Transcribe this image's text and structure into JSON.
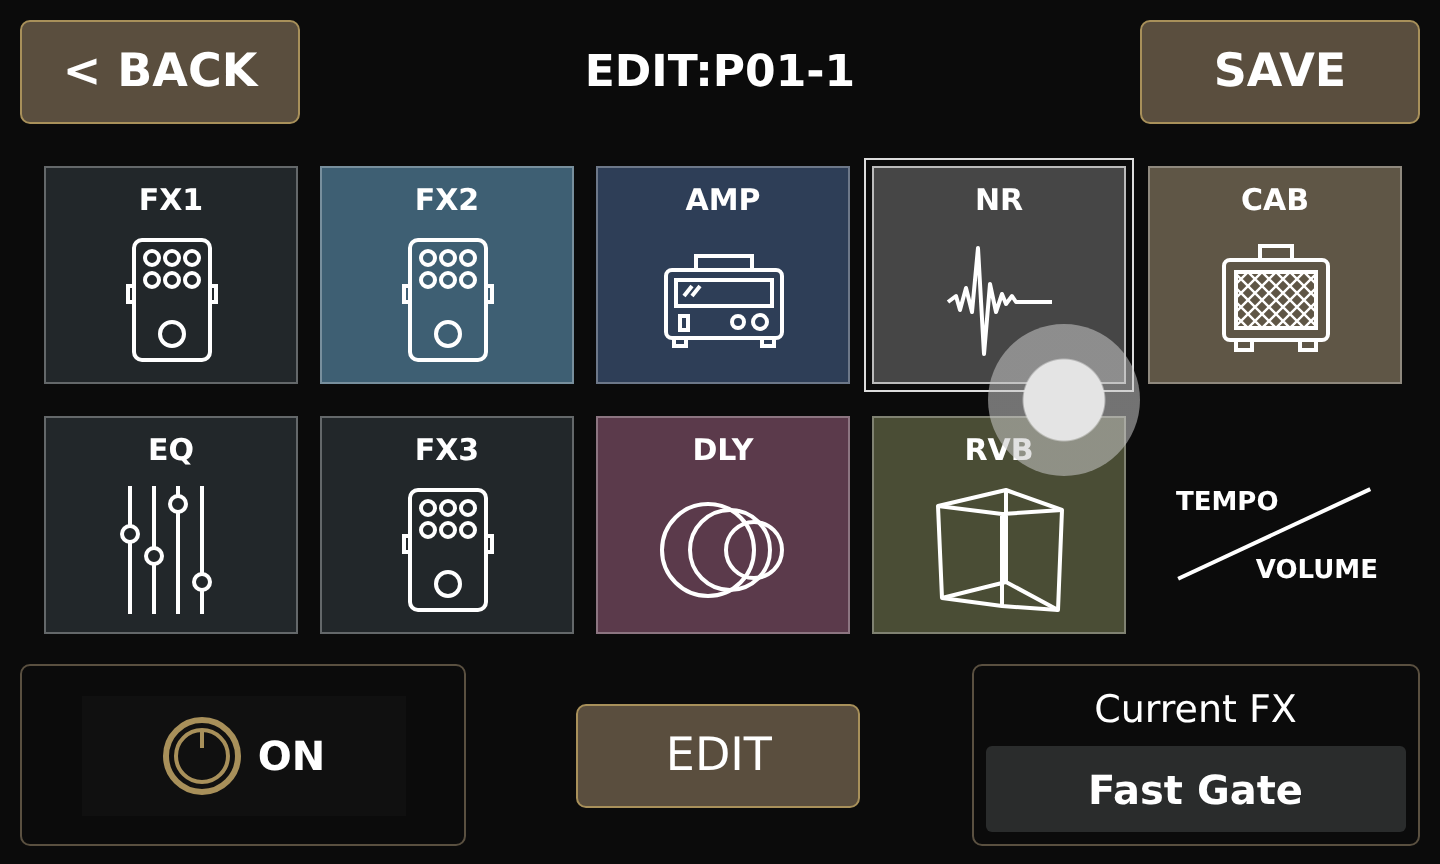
{
  "header": {
    "back": "< BACK",
    "title": "EDIT:P01-1",
    "save": "SAVE"
  },
  "blocks": [
    {
      "label": "FX1",
      "kind": "pedal",
      "color": "#22272a",
      "selected": false
    },
    {
      "label": "FX2",
      "kind": "pedal",
      "color": "#3e5f73",
      "selected": false
    },
    {
      "label": "AMP",
      "kind": "amp",
      "color": "#2e3e57",
      "selected": false
    },
    {
      "label": "NR",
      "kind": "wave",
      "color": "#464646",
      "selected": true
    },
    {
      "label": "CAB",
      "kind": "cabinet",
      "color": "#5f5646",
      "selected": false
    },
    {
      "label": "EQ",
      "kind": "sliders",
      "color": "#22272a",
      "selected": false
    },
    {
      "label": "FX3",
      "kind": "pedal",
      "color": "#22272a",
      "selected": false
    },
    {
      "label": "DLY",
      "kind": "rings",
      "color": "#5b3a4b",
      "selected": false
    },
    {
      "label": "RVB",
      "kind": "cube",
      "color": "#4a4d35",
      "selected": false
    }
  ],
  "tempo_volume": {
    "top": "TEMPO",
    "bottom": "VOLUME"
  },
  "power": {
    "on": true,
    "label": "ON"
  },
  "edit_button": "EDIT",
  "current_fx": {
    "label": "Current FX",
    "value": "Fast Gate"
  }
}
